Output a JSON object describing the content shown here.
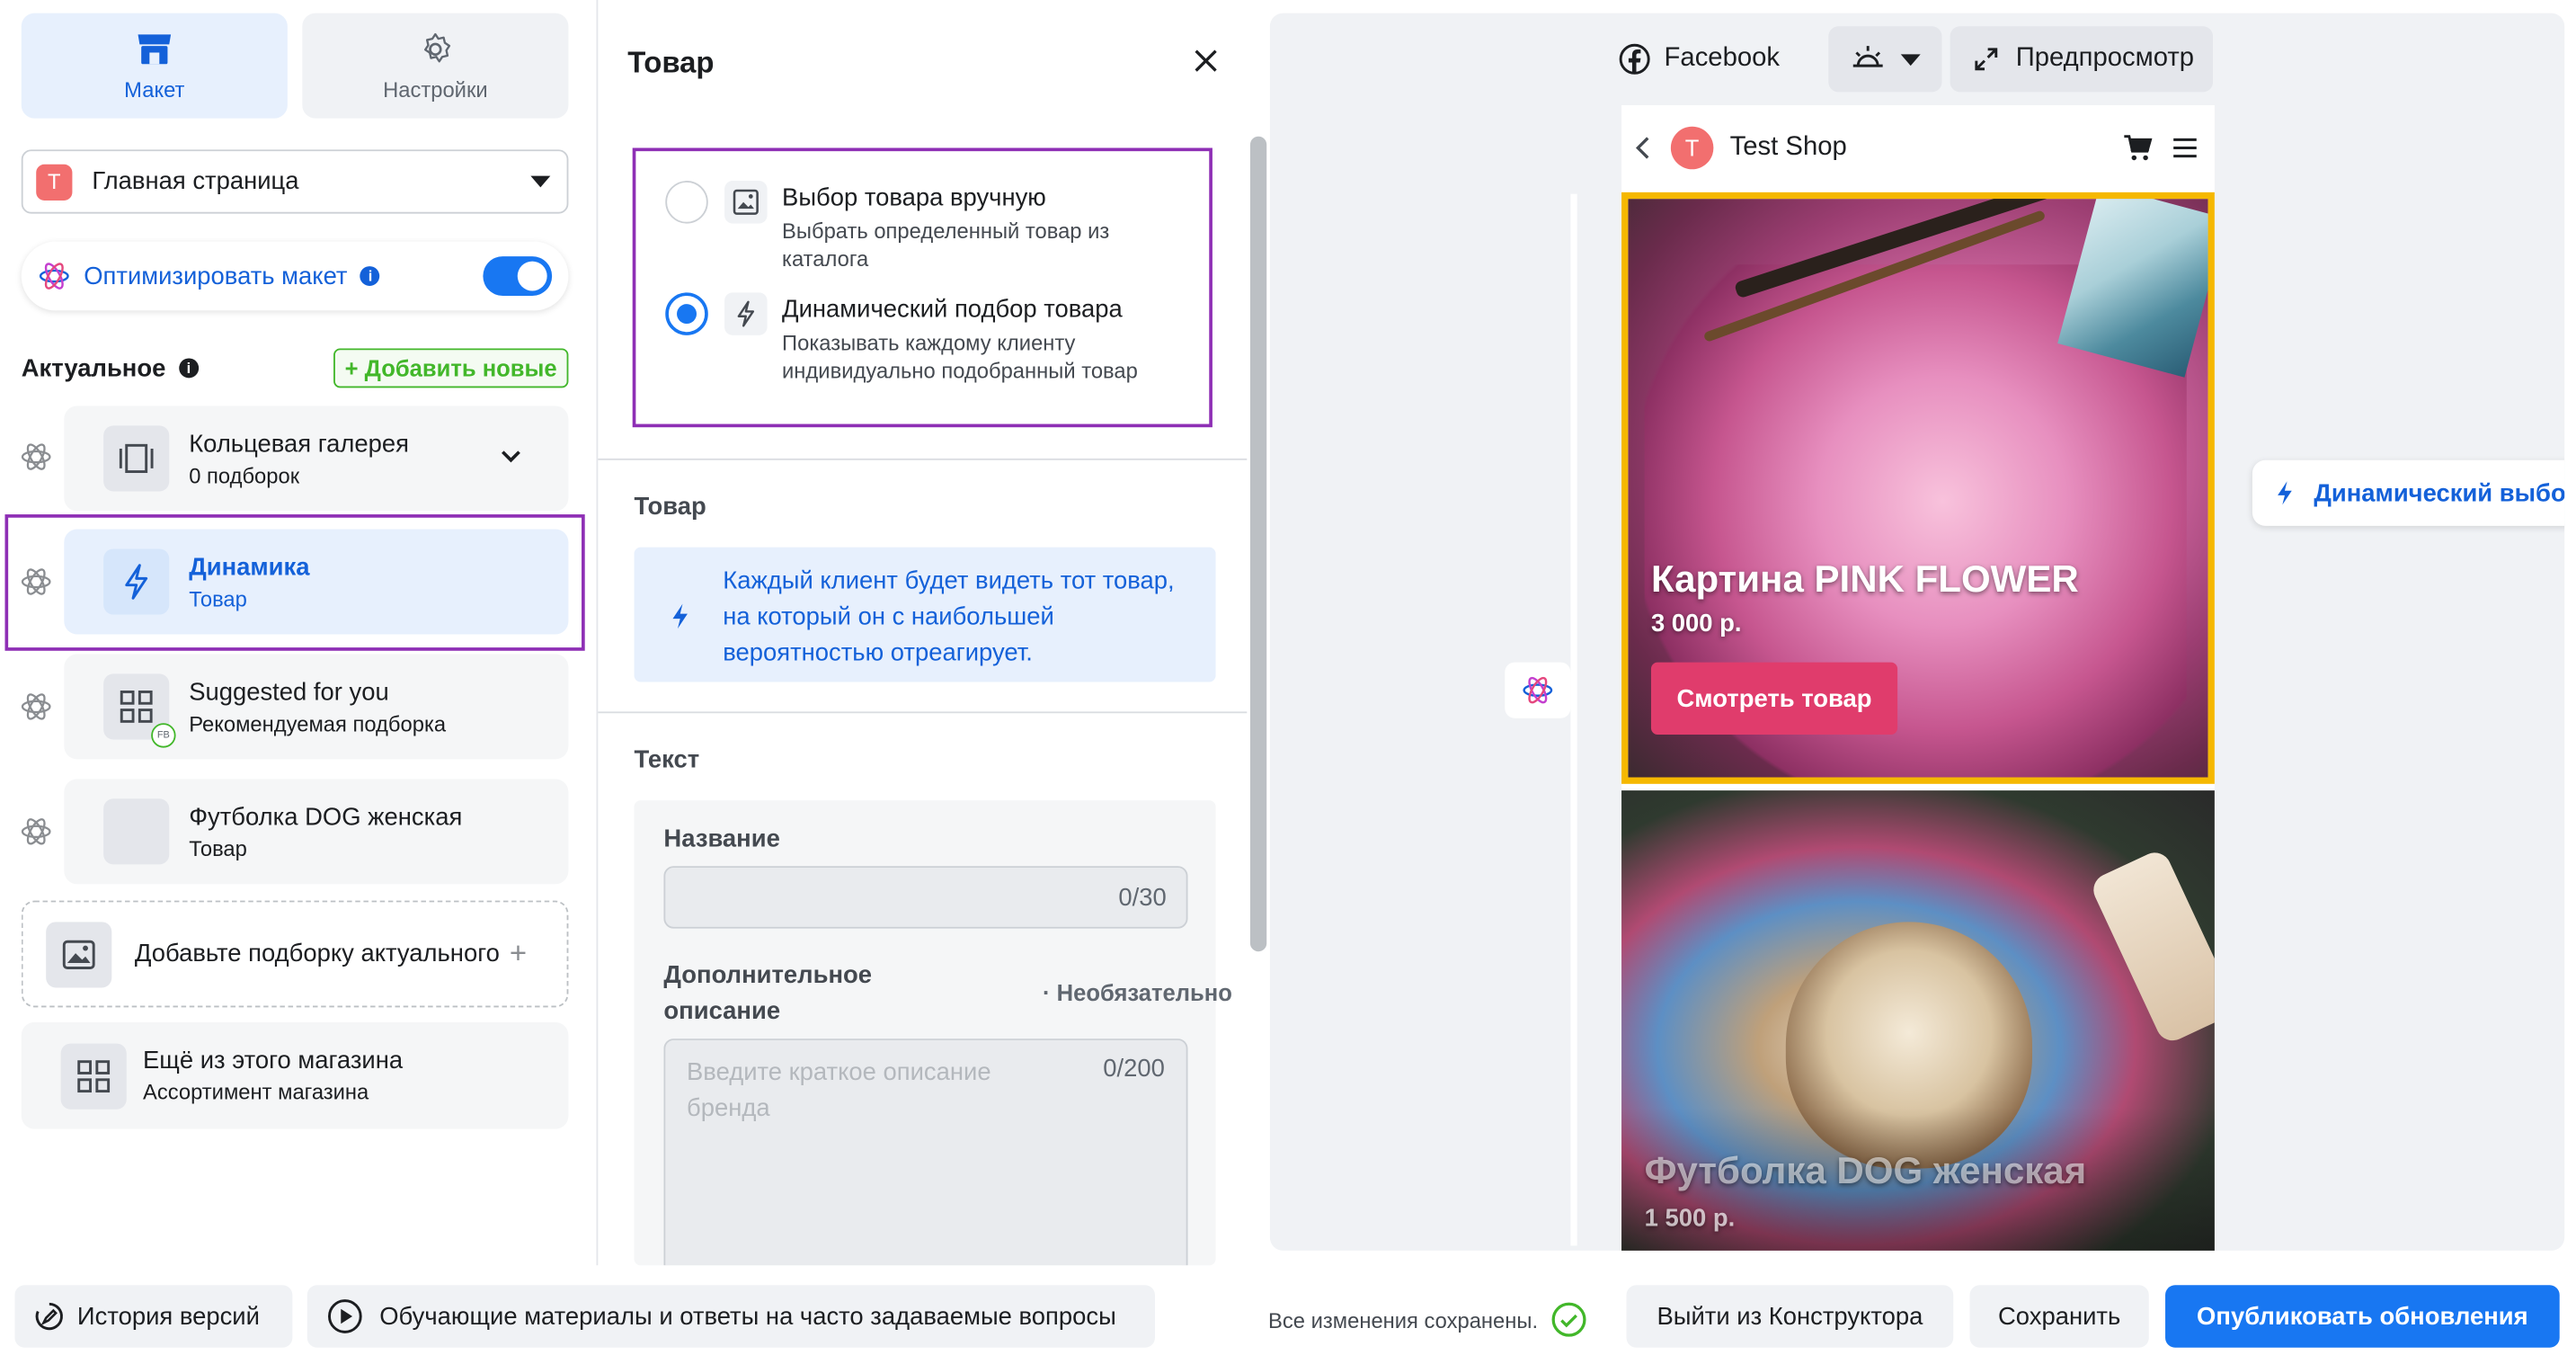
{
  "left": {
    "tabs": [
      {
        "label": "Макет",
        "icon": "shop-icon",
        "active": true
      },
      {
        "label": "Настройки",
        "icon": "gear-icon",
        "active": false
      }
    ],
    "page_select": {
      "badge": "T",
      "value": "Главная страница"
    },
    "optimize": {
      "label": "Оптимизировать макет",
      "enabled": true
    },
    "section": {
      "title": "Актуальное",
      "add_label": "+ Добавить новые"
    },
    "items": [
      {
        "title": "Кольцевая галерея",
        "subtitle": "0 подборок"
      },
      {
        "title": "Динамика",
        "subtitle": "Товар"
      },
      {
        "title": "Suggested for you",
        "subtitle": "Рекомендуемая подборка",
        "badge": "FB"
      },
      {
        "title": "Футболка DOG женская",
        "subtitle": "Товар"
      }
    ],
    "add_collection": "Добавьте подборку актуального",
    "more": {
      "title": "Ещё из этого магазина",
      "subtitle": "Ассортимент магазина"
    }
  },
  "middle": {
    "title": "Товар",
    "choices": [
      {
        "title": "Выбор товара вручную",
        "desc": "Выбрать определенный товар из каталога",
        "selected": false
      },
      {
        "title": "Динамический подбор товара",
        "desc": "Показывать каждому клиенту индивидуально подобранный товар",
        "selected": true
      }
    ],
    "product_heading": "Товар",
    "notice": "Каждый клиент будет видеть тот товар, на который он с наибольшей вероятностью отреагирует.",
    "text_heading": "Текст",
    "name_label": "Название",
    "name_counter": "0/30",
    "desc_label": "Дополнительное описание",
    "desc_optional": "· Необязательно",
    "desc_placeholder": "Введите краткое описание бренда",
    "desc_counter": "0/200"
  },
  "preview": {
    "platform": "Facebook",
    "preview_label": "Предпросмотр",
    "shop_badge": "T",
    "shop_name": "Test Shop",
    "card1": {
      "title": "Картина PINK FLOWER",
      "price": "3 000 р.",
      "cta": "Смотреть товар"
    },
    "card2": {
      "title": "Футболка DOG женская",
      "price": "1 500 р."
    },
    "side_label": "Динамический выбор"
  },
  "bottom": {
    "history": "История версий",
    "tutorials": "Обучающие материалы и ответы на часто задаваемые вопросы",
    "saved": "Все изменения сохранены.",
    "exit": "Выйти из Конструктора",
    "save": "Сохранить",
    "publish": "Опубликовать обновления"
  },
  "colors": {
    "accent": "#1877f2",
    "highlight_frame": "#8e2fb5",
    "card_frame": "#f5b800",
    "cta": "#e03c6c"
  }
}
